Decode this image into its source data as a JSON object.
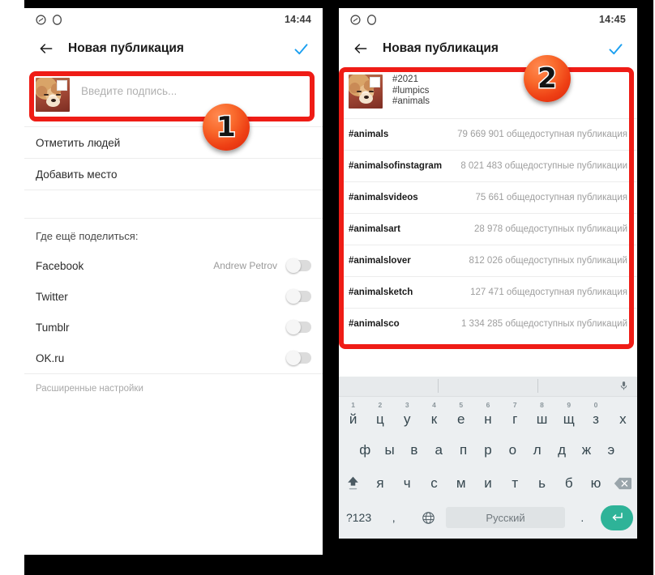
{
  "meta": {
    "left_phone_label": "instagram-new-post-caption-screen",
    "right_phone_label": "instagram-hashtag-suggestions-screen",
    "accent_blue": "#1a9ff0",
    "highlight_red": "#ef1c16",
    "badge_orange": "#f05020",
    "enter_key_green": "#2eb398"
  },
  "left": {
    "statusbar": {
      "clock": "14:44",
      "icons": [
        "shazam-icon",
        "opera-icon"
      ]
    },
    "appbar": {
      "back_icon": "back-arrow-icon",
      "title": "Новая публикация",
      "confirm_icon": "checkmark-icon"
    },
    "caption": {
      "placeholder": "Введите подпись...",
      "value": "",
      "thumbnail": "puppy-photo-thumbnail"
    },
    "rows": [
      {
        "label": "Отметить людей",
        "name": "tag-people-row"
      },
      {
        "label": "Добавить место",
        "name": "add-location-row"
      }
    ],
    "share_section_label": "Где ещё поделиться:",
    "share_targets": [
      {
        "label": "Facebook",
        "account": "Andrew Petrov",
        "enabled": false
      },
      {
        "label": "Twitter",
        "account": "",
        "enabled": false
      },
      {
        "label": "Tumblr",
        "account": "",
        "enabled": false
      },
      {
        "label": "OK.ru",
        "account": "",
        "enabled": false
      }
    ],
    "advanced_settings": "Расширенные настройки",
    "callout": "1"
  },
  "right": {
    "statusbar": {
      "clock": "14:45",
      "icons": [
        "shazam-icon",
        "opera-icon"
      ]
    },
    "appbar": {
      "back_icon": "back-arrow-icon",
      "title": "Новая публикация",
      "confirm_icon": "checkmark-icon"
    },
    "caption": {
      "thumbnail": "puppy-photo-thumbnail",
      "lines": [
        "#2021",
        "#lumpics",
        "#animals"
      ]
    },
    "suggestions": [
      {
        "tag": "#animals",
        "count": "79 669 901 общедоступная публикация"
      },
      {
        "tag": "#animalsofinstagram",
        "count": "8 021 483 общедоступные публикации"
      },
      {
        "tag": "#animalsvideos",
        "count": "75 661 общедоступная публикация"
      },
      {
        "tag": "#animalsart",
        "count": "28 978 общедоступных публикаций"
      },
      {
        "tag": "#animalslover",
        "count": "812 026 общедоступных публикаций"
      },
      {
        "tag": "#animalsketch",
        "count": "127 471 общедоступная публикация"
      },
      {
        "tag": "#animalsco",
        "count": "1 334 285 общедоступных публикаций"
      }
    ],
    "callout": "2",
    "keyboard": {
      "mic_icon": "microphone-icon",
      "row1": [
        {
          "key": "й",
          "num": "1"
        },
        {
          "key": "ц",
          "num": "2"
        },
        {
          "key": "у",
          "num": "3"
        },
        {
          "key": "к",
          "num": "4"
        },
        {
          "key": "е",
          "num": "5"
        },
        {
          "key": "н",
          "num": "6"
        },
        {
          "key": "г",
          "num": "7"
        },
        {
          "key": "ш",
          "num": "8"
        },
        {
          "key": "щ",
          "num": "9"
        },
        {
          "key": "з",
          "num": "0"
        },
        {
          "key": "х",
          "num": ""
        }
      ],
      "row2": [
        "ф",
        "ы",
        "в",
        "а",
        "п",
        "р",
        "о",
        "л",
        "д",
        "ж",
        "э"
      ],
      "row3_shift": "shift-icon",
      "row3": [
        "я",
        "ч",
        "с",
        "м",
        "и",
        "т",
        "ь",
        "б",
        "ю"
      ],
      "row3_backspace": "backspace-icon",
      "row4": {
        "symbols": "?123",
        "comma": ",",
        "globe_icon": "globe-icon",
        "spacebar": "Русский",
        "period": ".",
        "enter_icon": "enter-icon"
      }
    }
  }
}
